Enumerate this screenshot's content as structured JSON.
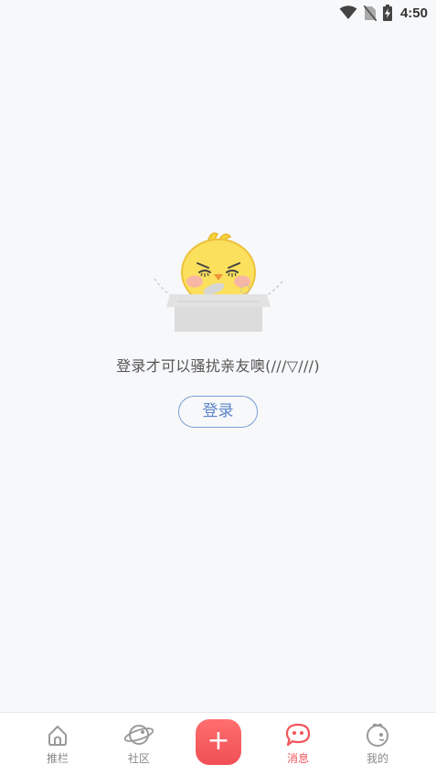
{
  "status_bar": {
    "time": "4:50",
    "icons": [
      "wifi-icon",
      "no-sim-icon",
      "battery-charging-icon"
    ]
  },
  "empty_state": {
    "message": "登录才可以骚扰亲友噢(///▽///)",
    "login_label": "登录",
    "illustration": "chick-mascot-icon"
  },
  "tab_bar": {
    "active": "消息",
    "tabs": [
      {
        "label": "推栏",
        "icon": "home-icon"
      },
      {
        "label": "社区",
        "icon": "planet-icon"
      },
      {
        "label": "",
        "icon": "plus-icon"
      },
      {
        "label": "消息",
        "icon": "chat-bubble-icon"
      },
      {
        "label": "我的",
        "icon": "profile-icon"
      }
    ]
  },
  "colors": {
    "accent": "#f2555c",
    "login_border": "#7a9fd7",
    "background": "#f7f8fa"
  }
}
